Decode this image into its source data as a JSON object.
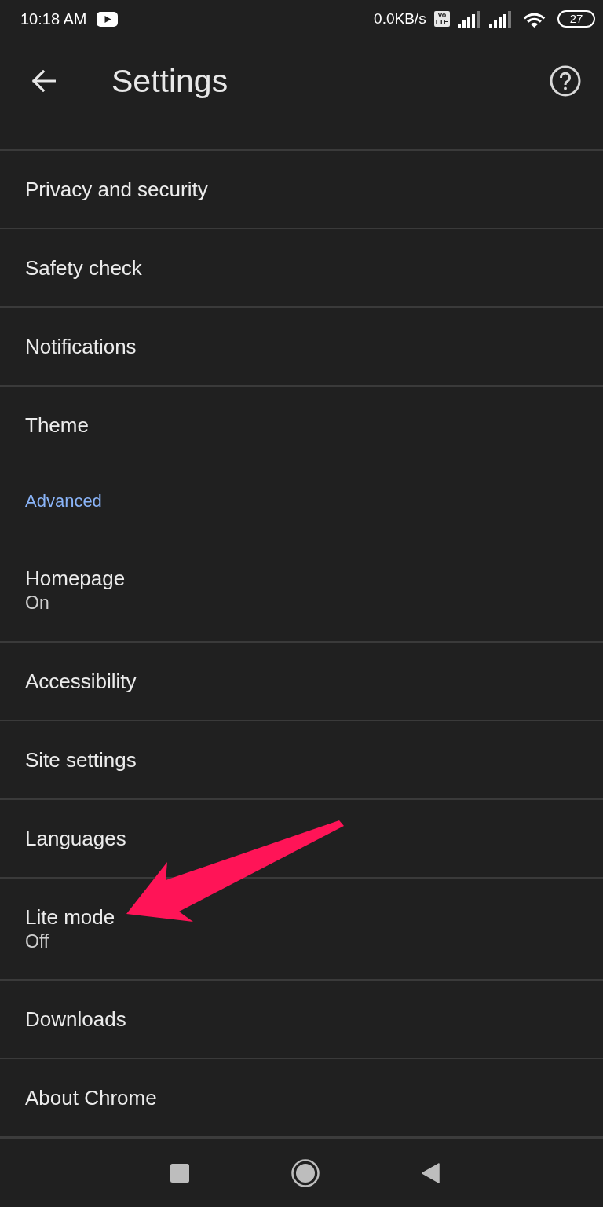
{
  "status_bar": {
    "time": "10:18 AM",
    "net_speed": "0.0KB/s",
    "volte": [
      "Vo",
      "LTE"
    ],
    "battery": "27"
  },
  "app_bar": {
    "title": "Settings"
  },
  "rows": [
    {
      "kind": "item",
      "title": "Privacy and security"
    },
    {
      "kind": "item",
      "title": "Safety check"
    },
    {
      "kind": "item",
      "title": "Notifications"
    },
    {
      "kind": "item",
      "title": "Theme"
    },
    {
      "kind": "header",
      "title": "Advanced"
    },
    {
      "kind": "item",
      "title": "Homepage",
      "summary": "On"
    },
    {
      "kind": "item",
      "title": "Accessibility"
    },
    {
      "kind": "item",
      "title": "Site settings"
    },
    {
      "kind": "item",
      "title": "Languages"
    },
    {
      "kind": "item",
      "title": "Lite mode",
      "summary": "Off"
    },
    {
      "kind": "item",
      "title": "Downloads"
    },
    {
      "kind": "item",
      "title": "About Chrome"
    }
  ],
  "annotations": [
    {
      "kind": "arrow"
    }
  ]
}
